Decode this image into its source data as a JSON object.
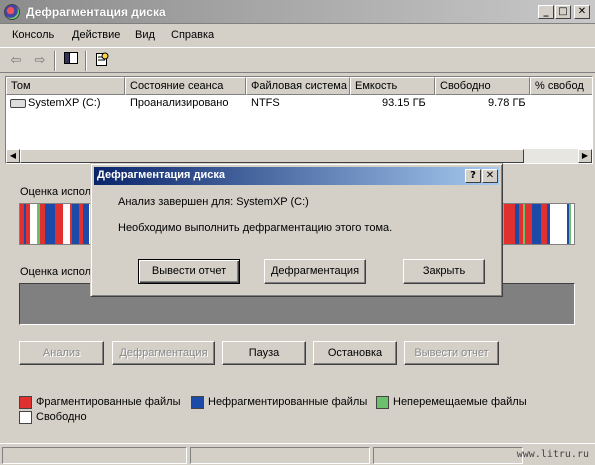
{
  "window": {
    "title": "Дефрагментация диска",
    "controls": {
      "minimize": "_",
      "maximize": "□",
      "close": "✕"
    }
  },
  "menu": [
    "Консоль",
    "Действие",
    "Вид",
    "Справка"
  ],
  "toolbar": {
    "icons": [
      "back-arrow-icon",
      "forward-arrow-icon",
      "console-tree-icon",
      "properties-icon"
    ]
  },
  "volumes": {
    "columns": [
      "Том",
      "Состояние сеанса",
      "Файловая система",
      "Емкость",
      "Свободно",
      "% свобод"
    ],
    "rows": [
      {
        "volume": "SystemXP (C:)",
        "status": "Проанализировано",
        "fs": "NTFS",
        "capacity": "93.15 ГБ",
        "free": "9.78 ГБ",
        "pct": ""
      }
    ]
  },
  "analysis": {
    "before_label": "Оценка исполь",
    "after_label": "Оценка исполь"
  },
  "buttons": {
    "analyze": "Анализ",
    "defragment": "Дефрагментация",
    "pause": "Пауза",
    "stop": "Остановка",
    "report": "Вывести отчет"
  },
  "legend": [
    {
      "label": "Фрагментированные файлы",
      "color": "#e03030"
    },
    {
      "label": "Нефрагментированные файлы",
      "color": "#1c4aa8"
    },
    {
      "label": "Неперемещаемые файлы",
      "color": "#6cc06c"
    },
    {
      "label": "Свободно",
      "color": "#ffffff"
    }
  ],
  "dialog": {
    "title": "Дефрагментация диска",
    "help": "?",
    "close": "✕",
    "line1": "Анализ завершен для: SystemXP (C:)",
    "line2": "Необходимо выполнить дефрагментацию этого тома.",
    "btn_report": "Вывести отчет",
    "btn_defrag": "Дефрагментация",
    "btn_close": "Закрыть"
  },
  "watermark": "www.litru.ru",
  "colors": {
    "fragmented": "#e03030",
    "contiguous": "#1c4aa8",
    "unmovable": "#6cc06c",
    "free": "#ffffff"
  }
}
